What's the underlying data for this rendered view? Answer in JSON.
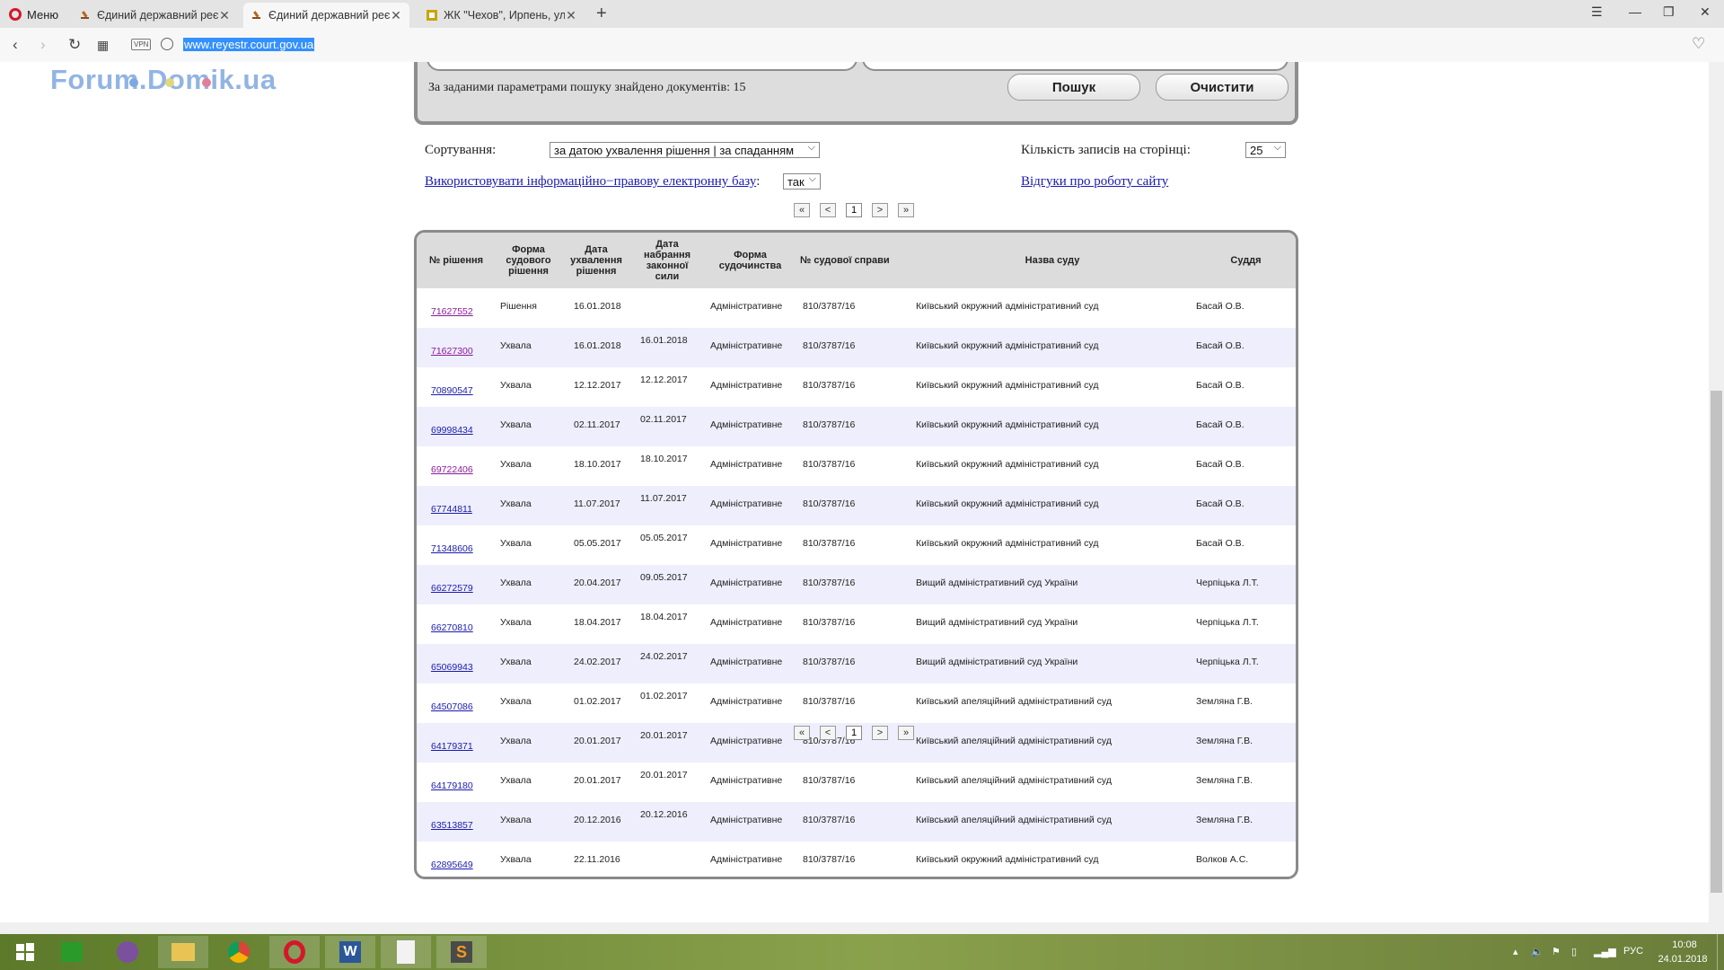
{
  "browser": {
    "menu_label": "Меню",
    "tabs": [
      {
        "title": "Єдиний державний реєст"
      },
      {
        "title": "Єдиний державний реєст"
      },
      {
        "title": "ЖК \"Чехов\", Ирпень, ул."
      }
    ],
    "url": "www.reyestr.court.gov.ua",
    "vpn_label": "VPN"
  },
  "watermark": "Forum.Domik.ua",
  "search": {
    "results_text": "За заданими параметрами пошуку знайдено документів: 15",
    "search_button": "Пошук",
    "clear_button": "Очистити"
  },
  "options": {
    "sort_label": "Сортування:",
    "sort_value": "за датою ухвалення рішення | за спаданням",
    "per_page_label": "Кількість записів на сторінці:",
    "per_page_value": "25",
    "use_base_link": "Використовувати інформаційно−правову електронну базу",
    "use_base_colon": ":",
    "use_base_value": "так",
    "feedback_link": "Відгуки про роботу сайту"
  },
  "pager": {
    "first": "«",
    "prev": "<",
    "page": "1",
    "next": ">",
    "last": "»"
  },
  "table": {
    "headers": [
      "№ рішення",
      "Форма судового рішення",
      "Дата ухвалення рішення",
      "Дата набрання законної сили",
      "Форма судочинства",
      "№ судової справи",
      "Назва суду",
      "Суддя"
    ],
    "rows": [
      {
        "id": "71627552",
        "form": "Рішення",
        "date": "16.01.2018",
        "legal": "",
        "proc": "Адміністративне",
        "case": "810/3787/16",
        "court": "Київський окружний адміністративний суд",
        "judge": "Басай О.В.",
        "visited": true
      },
      {
        "id": "71627300",
        "form": "Ухвала",
        "date": "16.01.2018",
        "legal": "16.01.2018",
        "proc": "Адміністративне",
        "case": "810/3787/16",
        "court": "Київський окружний адміністративний суд",
        "judge": "Басай О.В.",
        "visited": true
      },
      {
        "id": "70890547",
        "form": "Ухвала",
        "date": "12.12.2017",
        "legal": "12.12.2017",
        "proc": "Адміністративне",
        "case": "810/3787/16",
        "court": "Київський окружний адміністративний суд",
        "judge": "Басай О.В.",
        "visited": false
      },
      {
        "id": "69998434",
        "form": "Ухвала",
        "date": "02.11.2017",
        "legal": "02.11.2017",
        "proc": "Адміністративне",
        "case": "810/3787/16",
        "court": "Київський окружний адміністративний суд",
        "judge": "Басай О.В.",
        "visited": false
      },
      {
        "id": "69722406",
        "form": "Ухвала",
        "date": "18.10.2017",
        "legal": "18.10.2017",
        "proc": "Адміністративне",
        "case": "810/3787/16",
        "court": "Київський окружний адміністративний суд",
        "judge": "Басай О.В.",
        "visited": true
      },
      {
        "id": "67744811",
        "form": "Ухвала",
        "date": "11.07.2017",
        "legal": "11.07.2017",
        "proc": "Адміністративне",
        "case": "810/3787/16",
        "court": "Київський окружний адміністративний суд",
        "judge": "Басай О.В.",
        "visited": false
      },
      {
        "id": "71348606",
        "form": "Ухвала",
        "date": "05.05.2017",
        "legal": "05.05.2017",
        "proc": "Адміністративне",
        "case": "810/3787/16",
        "court": "Київський окружний адміністративний суд",
        "judge": "Басай О.В.",
        "visited": false
      },
      {
        "id": "66272579",
        "form": "Ухвала",
        "date": "20.04.2017",
        "legal": "09.05.2017",
        "proc": "Адміністративне",
        "case": "810/3787/16",
        "court": "Вищий адміністративний суд України",
        "judge": "Черпіцька Л.Т.",
        "visited": false
      },
      {
        "id": "66270810",
        "form": "Ухвала",
        "date": "18.04.2017",
        "legal": "18.04.2017",
        "proc": "Адміністративне",
        "case": "810/3787/16",
        "court": "Вищий адміністративний суд України",
        "judge": "Черпіцька Л.Т.",
        "visited": false
      },
      {
        "id": "65069943",
        "form": "Ухвала",
        "date": "24.02.2017",
        "legal": "24.02.2017",
        "proc": "Адміністративне",
        "case": "810/3787/16",
        "court": "Вищий адміністративний суд України",
        "judge": "Черпіцька Л.Т.",
        "visited": false
      },
      {
        "id": "64507086",
        "form": "Ухвала",
        "date": "01.02.2017",
        "legal": "01.02.2017",
        "proc": "Адміністративне",
        "case": "810/3787/16",
        "court": "Київський апеляційний адміністративний суд",
        "judge": "Земляна Г.В.",
        "visited": false
      },
      {
        "id": "64179371",
        "form": "Ухвала",
        "date": "20.01.2017",
        "legal": "20.01.2017",
        "proc": "Адміністративне",
        "case": "810/3787/16",
        "court": "Київський апеляційний адміністративний суд",
        "judge": "Земляна Г.В.",
        "visited": false
      },
      {
        "id": "64179180",
        "form": "Ухвала",
        "date": "20.01.2017",
        "legal": "20.01.2017",
        "proc": "Адміністративне",
        "case": "810/3787/16",
        "court": "Київський апеляційний адміністративний суд",
        "judge": "Земляна Г.В.",
        "visited": false
      },
      {
        "id": "63513857",
        "form": "Ухвала",
        "date": "20.12.2016",
        "legal": "20.12.2016",
        "proc": "Адміністративне",
        "case": "810/3787/16",
        "court": "Київський апеляційний адміністративний суд",
        "judge": "Земляна Г.В.",
        "visited": false
      },
      {
        "id": "62895649",
        "form": "Ухвала",
        "date": "22.11.2016",
        "legal": "",
        "proc": "Адміністративне",
        "case": "810/3787/16",
        "court": "Київський окружний адміністративний суд",
        "judge": "Волков А.С.",
        "visited": false
      }
    ]
  },
  "taskbar": {
    "language": "РУС",
    "time": "10:08",
    "date": "24.01.2018"
  },
  "colors": {
    "link": "#1a1ab0",
    "visited_link": "#8a1a9a",
    "row_alt": "#eeeefc",
    "header_bg": "#dcdcdc"
  }
}
